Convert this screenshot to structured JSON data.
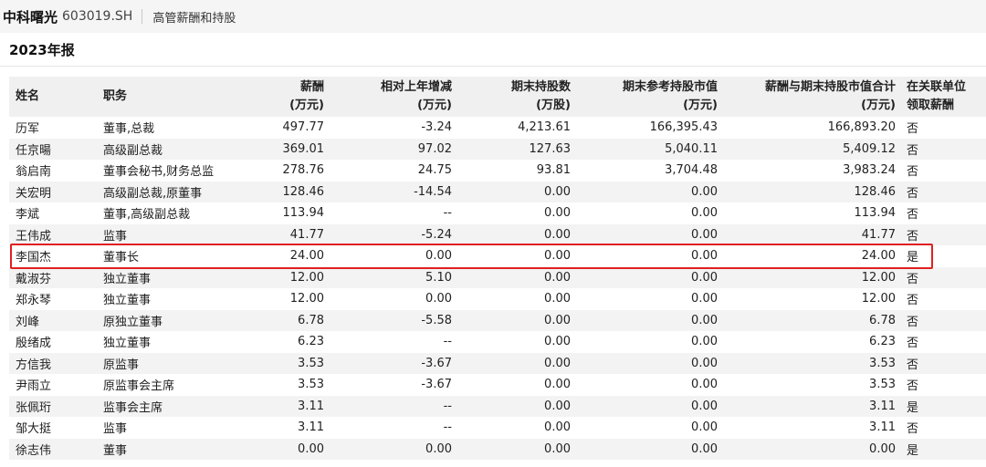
{
  "header": {
    "company_name": "中科曙光",
    "stock_code": "603019.SH",
    "section_title": "高管薪酬和持股"
  },
  "report": {
    "year_label": "2023年报"
  },
  "table": {
    "columns": [
      {
        "line1": "姓名",
        "line2": ""
      },
      {
        "line1": "职务",
        "line2": ""
      },
      {
        "line1": "薪酬",
        "line2": "(万元)"
      },
      {
        "line1": "相对上年增减",
        "line2": "(万元)"
      },
      {
        "line1": "期末持股数",
        "line2": "(万股)"
      },
      {
        "line1": "期末参考持股市值",
        "line2": "(万元)"
      },
      {
        "line1": "薪酬与期末持股市值合计",
        "line2": "(万元)"
      },
      {
        "line1": "在关联单位",
        "line2": "领取薪酬"
      }
    ],
    "rows": [
      {
        "name": "历军",
        "position": "董事,总裁",
        "salary": "497.77",
        "change": "-3.24",
        "shares": "4,213.61",
        "market_value": "166,395.43",
        "total": "166,893.20",
        "related_pay": "否"
      },
      {
        "name": "任京暘",
        "position": "高级副总裁",
        "salary": "369.01",
        "change": "97.02",
        "shares": "127.63",
        "market_value": "5,040.11",
        "total": "5,409.12",
        "related_pay": "否"
      },
      {
        "name": "翁启南",
        "position": "董事会秘书,财务总监",
        "salary": "278.76",
        "change": "24.75",
        "shares": "93.81",
        "market_value": "3,704.48",
        "total": "3,983.24",
        "related_pay": "否"
      },
      {
        "name": "关宏明",
        "position": "高级副总裁,原董事",
        "salary": "128.46",
        "change": "-14.54",
        "shares": "0.00",
        "market_value": "0.00",
        "total": "128.46",
        "related_pay": "否"
      },
      {
        "name": "李斌",
        "position": "董事,高级副总裁",
        "salary": "113.94",
        "change": "--",
        "shares": "0.00",
        "market_value": "0.00",
        "total": "113.94",
        "related_pay": "否"
      },
      {
        "name": "王伟成",
        "position": "监事",
        "salary": "41.77",
        "change": "-5.24",
        "shares": "0.00",
        "market_value": "0.00",
        "total": "41.77",
        "related_pay": "否"
      },
      {
        "name": "李国杰",
        "position": "董事长",
        "salary": "24.00",
        "change": "0.00",
        "shares": "0.00",
        "market_value": "0.00",
        "total": "24.00",
        "related_pay": "是"
      },
      {
        "name": "戴淑芬",
        "position": "独立董事",
        "salary": "12.00",
        "change": "5.10",
        "shares": "0.00",
        "market_value": "0.00",
        "total": "12.00",
        "related_pay": "否"
      },
      {
        "name": "郑永琴",
        "position": "独立董事",
        "salary": "12.00",
        "change": "0.00",
        "shares": "0.00",
        "market_value": "0.00",
        "total": "12.00",
        "related_pay": "否"
      },
      {
        "name": "刘峰",
        "position": "原独立董事",
        "salary": "6.78",
        "change": "-5.58",
        "shares": "0.00",
        "market_value": "0.00",
        "total": "6.78",
        "related_pay": "否"
      },
      {
        "name": "殷绪成",
        "position": "独立董事",
        "salary": "6.23",
        "change": "--",
        "shares": "0.00",
        "market_value": "0.00",
        "total": "6.23",
        "related_pay": "否"
      },
      {
        "name": "方信我",
        "position": "原监事",
        "salary": "3.53",
        "change": "-3.67",
        "shares": "0.00",
        "market_value": "0.00",
        "total": "3.53",
        "related_pay": "否"
      },
      {
        "name": "尹雨立",
        "position": "原监事会主席",
        "salary": "3.53",
        "change": "-3.67",
        "shares": "0.00",
        "market_value": "0.00",
        "total": "3.53",
        "related_pay": "否"
      },
      {
        "name": "张佩珩",
        "position": "监事会主席",
        "salary": "3.11",
        "change": "--",
        "shares": "0.00",
        "market_value": "0.00",
        "total": "3.11",
        "related_pay": "是"
      },
      {
        "name": "邹大挺",
        "position": "监事",
        "salary": "3.11",
        "change": "--",
        "shares": "0.00",
        "market_value": "0.00",
        "total": "3.11",
        "related_pay": "否"
      },
      {
        "name": "徐志伟",
        "position": "董事",
        "salary": "0.00",
        "change": "0.00",
        "shares": "0.00",
        "market_value": "0.00",
        "total": "0.00",
        "related_pay": "是"
      }
    ],
    "highlighted_row_name": "李国杰",
    "highlight_color": "#e02020"
  }
}
